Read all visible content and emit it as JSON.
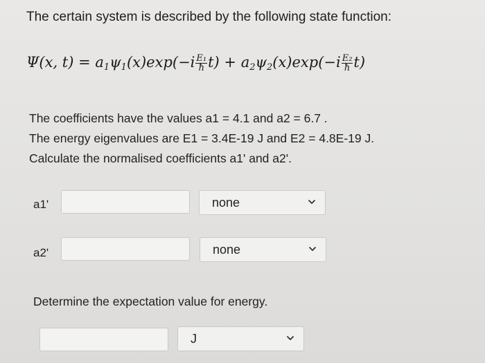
{
  "problem": {
    "intro": "The certain system is described by the following state function:",
    "equation": {
      "lhs": "Ψ(x, t) = ",
      "t1_coef": "a",
      "t1_coef_sub": "1",
      "t1_psi": "ψ",
      "t1_psi_sub": "1",
      "t1_mid": "(x)exp(−i",
      "t1_num": "E₁",
      "t1_den": "ħ",
      "t1_end": "t) + ",
      "t2_coef": "a",
      "t2_coef_sub": "2",
      "t2_psi": "ψ",
      "t2_psi_sub": "2",
      "t2_mid": "(x)exp(−i",
      "t2_num": "E₂",
      "t2_den": "ħ",
      "t2_end": "t)"
    },
    "line1": "The coefficients have the values a1 = 4.1  and a2 = 6.7 .",
    "line2": "The energy eigenvalues are E1 = 3.4E-19 J and E2 = 4.8E-19 J.",
    "line3": "Calculate the normalised coefficients a1' and a2'."
  },
  "answers": {
    "a1": {
      "label": "a1'",
      "value": "",
      "unit": "none"
    },
    "a2": {
      "label": "a2'",
      "value": "",
      "unit": "none"
    },
    "energy": {
      "question": "Determine the expectation value for energy.",
      "value": "",
      "unit": "J"
    }
  },
  "icons": {
    "dropdown": "chevron-down-icon",
    "accent": "#222222"
  }
}
